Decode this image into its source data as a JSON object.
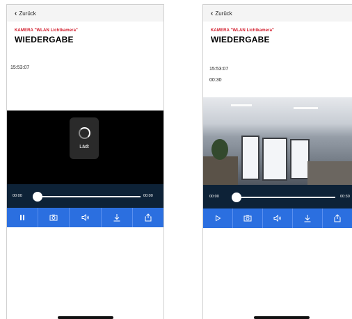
{
  "left": {
    "back_label": "Zurück",
    "camera_label": "KAMERA \"WLAN Lichtkamera\"",
    "title": "WIEDERGABE",
    "time": "15:53:07",
    "loading_label": "Lädt",
    "timeline_start": "00:00",
    "timeline_end": "00:00",
    "progress": 0,
    "buttons": [
      "pause-icon",
      "snapshot-icon",
      "speaker-icon",
      "download-icon",
      "share-icon"
    ]
  },
  "right": {
    "back_label": "Zurück",
    "camera_label": "KAMERA \"WLAN Lichtkamera\"",
    "title": "WIEDERGABE",
    "time": "15:53:07",
    "duration": "00:30",
    "timeline_start": "00:00",
    "timeline_end": "00:30",
    "progress": 0,
    "buttons": [
      "play-icon",
      "snapshot-icon",
      "speaker-icon",
      "download-icon",
      "share-icon"
    ]
  },
  "colors": {
    "accent": "#2b6fe0",
    "camera_red": "#d21a2a",
    "timeline_bg": "#0d2237"
  }
}
